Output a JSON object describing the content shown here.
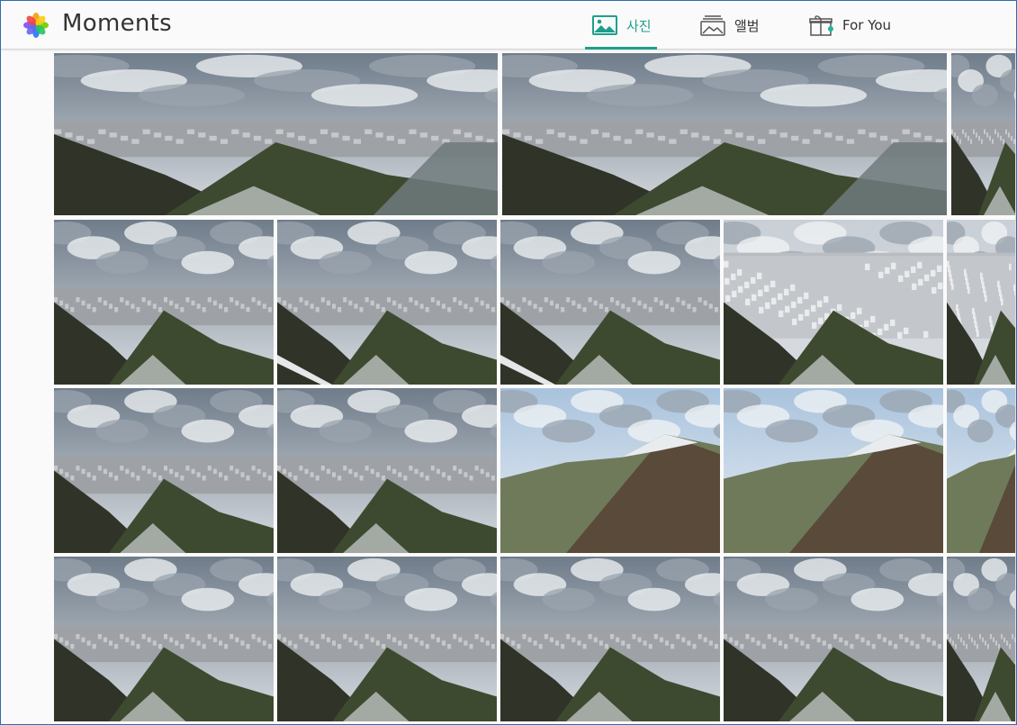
{
  "header": {
    "title": "Moments",
    "logo_icon": "photos-flower-icon"
  },
  "tabs": [
    {
      "id": "photos",
      "label": "사진",
      "icon": "photo-icon",
      "active": true
    },
    {
      "id": "albums",
      "label": "앨범",
      "icon": "album-stack-icon",
      "active": false
    },
    {
      "id": "foryou",
      "label": "For You",
      "icon": "gift-icon",
      "active": false,
      "has_notification": true
    }
  ],
  "colors": {
    "accent": "#1f9f8b",
    "notification_dot": "#1fb5a0"
  },
  "gallery": {
    "rows": [
      {
        "photos": [
          "cityscape-valley-cloudy",
          "cityscape-valley-cloudy",
          "cityscape-valley-cloudy"
        ]
      },
      {
        "photos": [
          "overcast-ridge",
          "overcast-ridge-railing",
          "overcast-ridge-railing",
          "dense-city-view",
          "dense-city-view"
        ]
      },
      {
        "photos": [
          "overcast-ridge",
          "overcast-ridge",
          "snowy-peak",
          "snowy-peak",
          "snowy-peak"
        ]
      },
      {
        "photos": [
          "hazy-mountain-city",
          "city-below-clouds",
          "city-below-clouds",
          "city-below-clouds",
          "city-below-clouds"
        ]
      }
    ]
  }
}
